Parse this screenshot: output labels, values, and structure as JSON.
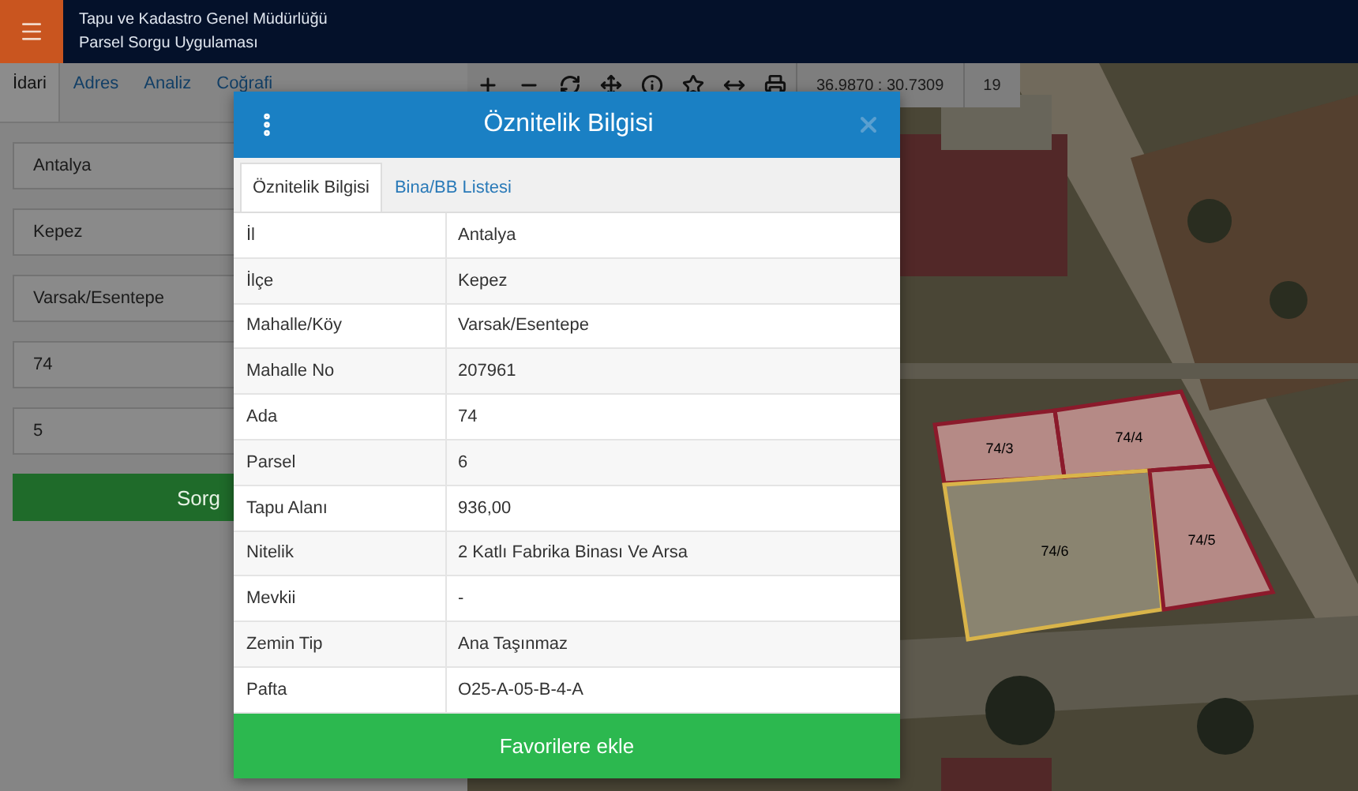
{
  "header": {
    "title": "Tapu ve Kadastro Genel Müdürlüğü",
    "subtitle": "Parsel Sorgu Uygulaması"
  },
  "sidebar": {
    "tabs": [
      {
        "label": "İdari",
        "selected": true
      },
      {
        "label": "Adres",
        "selected": false
      },
      {
        "label": "Analiz",
        "selected": false
      },
      {
        "label": "Coğrafi",
        "selected": false
      }
    ],
    "fields": [
      {
        "value": "Antalya"
      },
      {
        "value": "Kepez"
      },
      {
        "value": "Varsak/Esentepe"
      },
      {
        "value": "74"
      },
      {
        "value": "5"
      }
    ],
    "query_button": "Sorg"
  },
  "map": {
    "toolbar": {
      "coordinates": "36.9870 : 30.7309",
      "zoom": "19"
    },
    "parcels": [
      {
        "label": "74/3",
        "color": "#8b1a2b"
      },
      {
        "label": "74/4",
        "color": "#8b1a2b"
      },
      {
        "label": "74/6",
        "color": "#d9b44a"
      },
      {
        "label": "74/5",
        "color": "#8b1a2b"
      }
    ]
  },
  "dialog": {
    "title": "Öznitelik Bilgisi",
    "tabs": [
      {
        "label": "Öznitelik Bilgisi",
        "selected": true
      },
      {
        "label": "Bina/BB Listesi",
        "selected": false
      }
    ],
    "rows": [
      {
        "label": "İl",
        "value": "Antalya"
      },
      {
        "label": "İlçe",
        "value": "Kepez"
      },
      {
        "label": "Mahalle/Köy",
        "value": "Varsak/Esentepe"
      },
      {
        "label": "Mahalle No",
        "value": "207961"
      },
      {
        "label": "Ada",
        "value": "74"
      },
      {
        "label": "Parsel",
        "value": "6"
      },
      {
        "label": "Tapu Alanı",
        "value": "936,00"
      },
      {
        "label": "Nitelik",
        "value": "2 Katlı Fabrika Binası Ve Arsa"
      },
      {
        "label": "Mevkii",
        "value": "-"
      },
      {
        "label": "Zemin Tip",
        "value": "Ana Taşınmaz"
      },
      {
        "label": "Pafta",
        "value": "O25-A-05-B-4-A"
      }
    ],
    "button": "Favorilere ekle"
  }
}
